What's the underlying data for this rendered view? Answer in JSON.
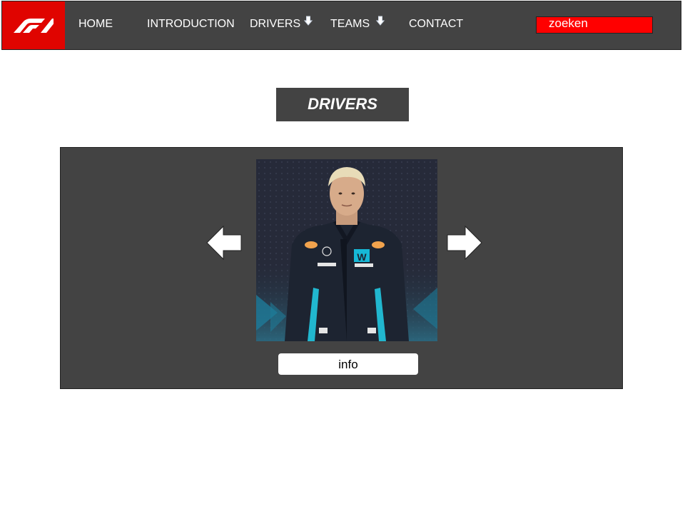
{
  "nav": {
    "logo_icon": "f1-logo",
    "brand_color": "#e00400",
    "items": [
      {
        "label": "HOME"
      },
      {
        "label": "INTRODUCTION"
      },
      {
        "label": "DRIVERS",
        "icon": "arrow-down-icon"
      },
      {
        "label": "TEAMS",
        "icon": "arrow-down-icon"
      },
      {
        "label": "CONTACT"
      }
    ],
    "search": {
      "value": "zoeken",
      "color": "#ff0000"
    }
  },
  "page": {
    "title": "DRIVERS"
  },
  "carousel": {
    "prev_icon": "arrow-left-icon",
    "next_icon": "arrow-right-icon",
    "photo_icon": "driver-photo",
    "info_label": "info"
  },
  "colors": {
    "panel": "#434343",
    "background": "#ffffff"
  }
}
